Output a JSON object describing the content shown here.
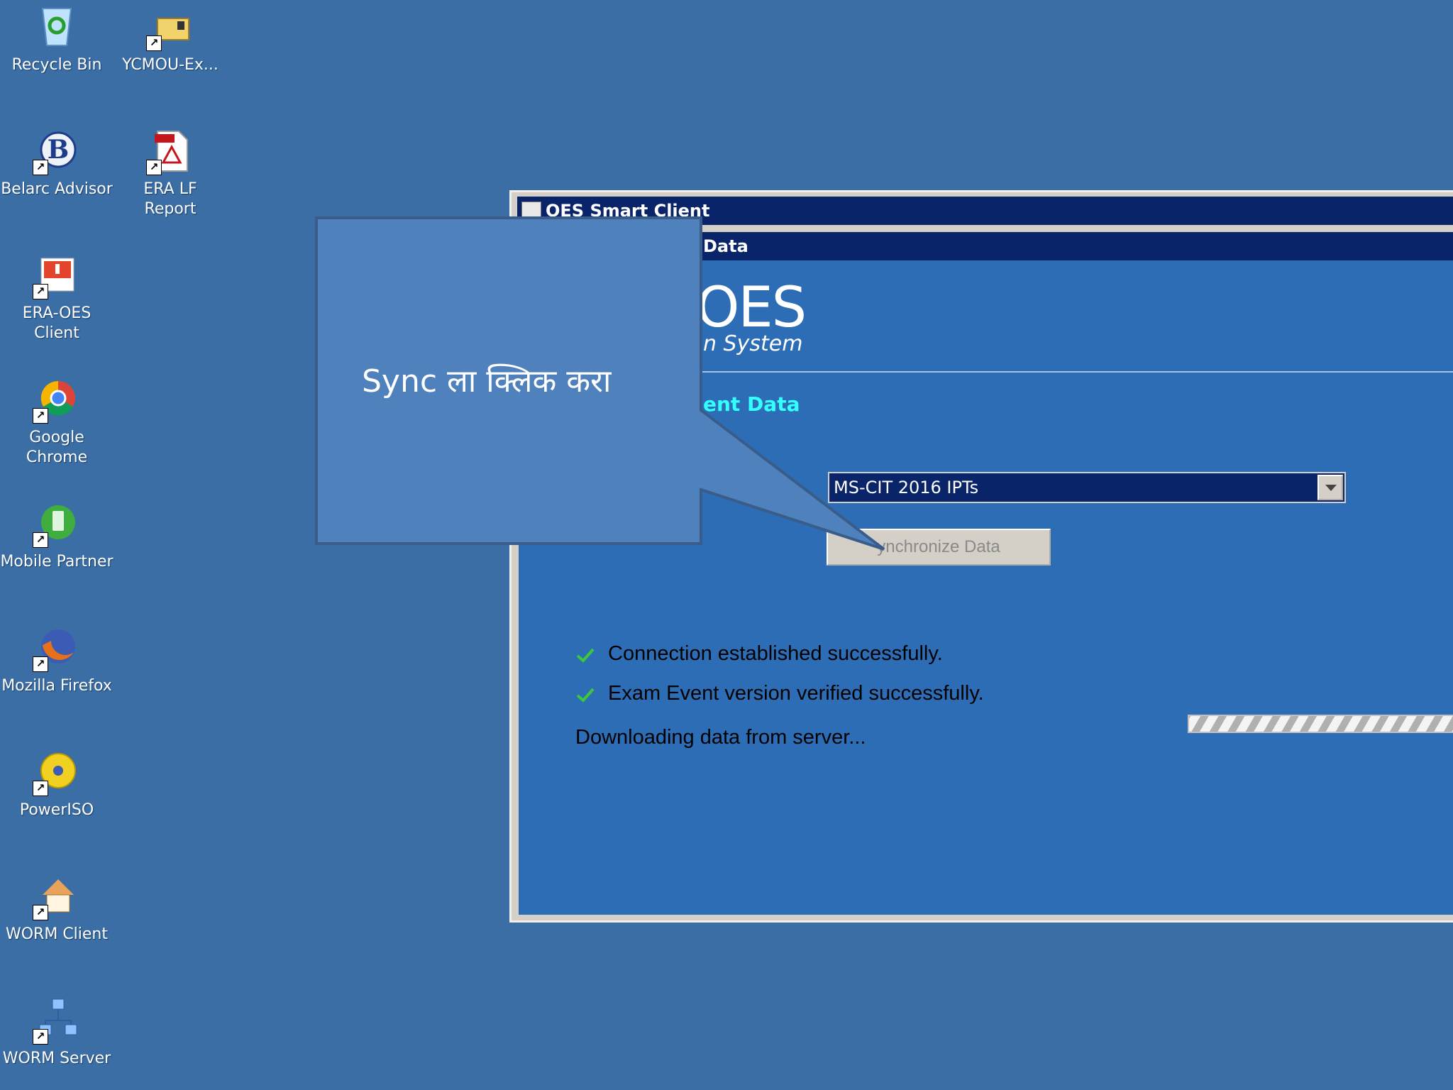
{
  "desktop": {
    "icons": [
      {
        "label": "Recycle Bin",
        "icon": "recycle-bin-icon"
      },
      {
        "label": "YCMOU-Ex...",
        "icon": "folder-lock-icon"
      },
      {
        "label": "Belarc Advisor",
        "icon": "belarc-icon"
      },
      {
        "label": "ERA  LF\nReport",
        "icon": "pdf-icon"
      },
      {
        "label": "ERA-OES\nClient",
        "icon": "era-oes-icon"
      },
      {
        "label": "Google\nChrome",
        "icon": "chrome-icon"
      },
      {
        "label": "Mobile Partner",
        "icon": "mobile-partner-icon"
      },
      {
        "label": "Mozilla Firefox",
        "icon": "firefox-icon"
      },
      {
        "label": "PowerISO",
        "icon": "poweriso-icon"
      },
      {
        "label": "WORM Client",
        "icon": "worm-client-icon"
      },
      {
        "label": "WORM Server",
        "icon": "worm-server-icon"
      }
    ],
    "background_color": "#3a6ea5"
  },
  "window": {
    "title": "OES Smart Client",
    "subtitle": "Data",
    "logo_text": "OES",
    "logo_subtext": "n System",
    "section_title": "ent Data",
    "exam_select_value": "MS-CIT 2016 IPTs",
    "sync_button_label": "ynchronize Data",
    "status": [
      {
        "text": "Connection established successfully.",
        "ok": true
      },
      {
        "text": "Exam Event version verified successfully.",
        "ok": true
      },
      {
        "text": "Downloading data from server...",
        "ok": false
      }
    ]
  },
  "callout": {
    "text": "Sync ला  क्लिक  करा"
  }
}
